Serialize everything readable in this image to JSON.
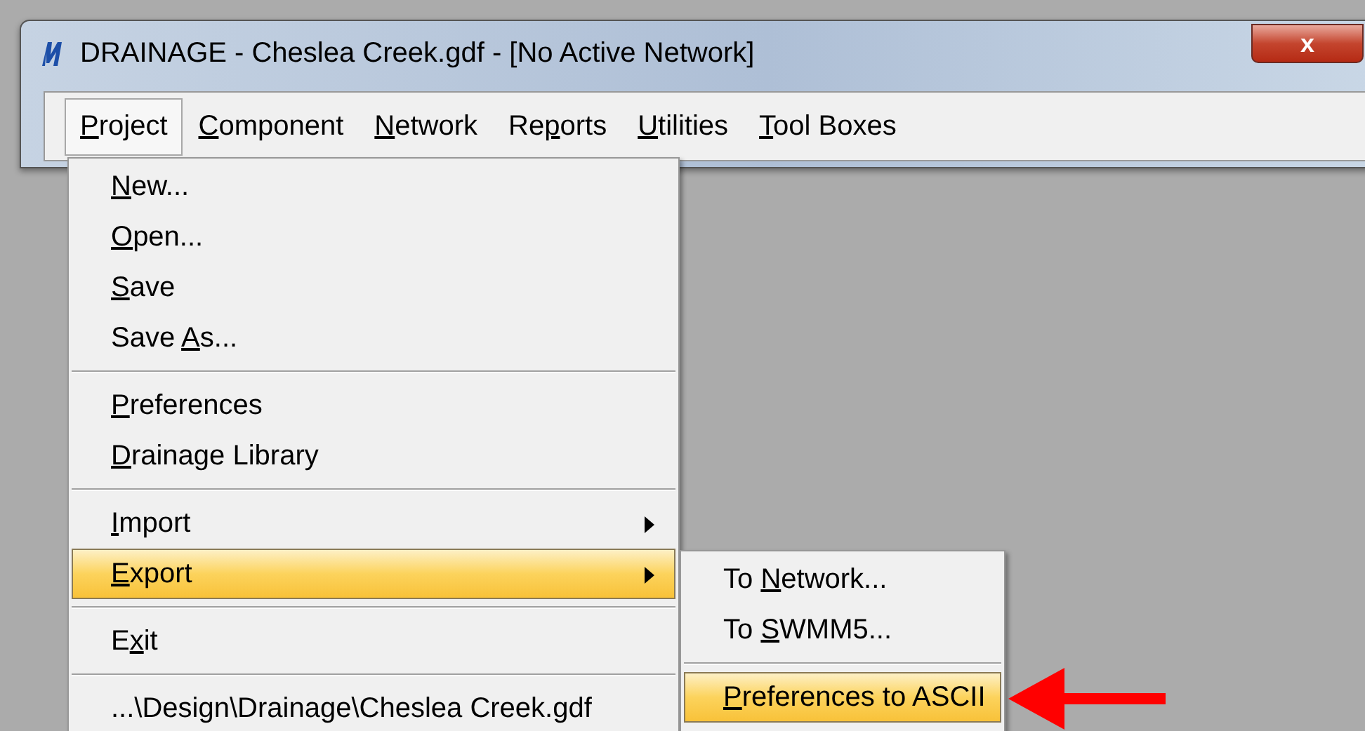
{
  "window": {
    "title": "DRAINAGE - Cheslea Creek.gdf - [No Active Network]",
    "close": "x"
  },
  "menubar": [
    {
      "label": {
        "key": "P",
        "post": "roject"
      },
      "selected": true
    },
    {
      "label": {
        "key": "C",
        "post": "omponent"
      },
      "selected": false
    },
    {
      "label": {
        "key": "N",
        "post": "etwork"
      },
      "selected": false
    },
    {
      "label": {
        "pre": "Re",
        "key": "p",
        "post": "orts"
      },
      "selected": false
    },
    {
      "label": {
        "key": "U",
        "post": "tilities"
      },
      "selected": false
    },
    {
      "label": {
        "key": "T",
        "post": "ool Boxes"
      },
      "selected": false
    }
  ],
  "project_menu": [
    {
      "kind": "item",
      "label": {
        "key": "N",
        "post": "ew..."
      },
      "selected": false,
      "submenu": false
    },
    {
      "kind": "item",
      "label": {
        "key": "O",
        "post": "pen..."
      },
      "selected": false,
      "submenu": false
    },
    {
      "kind": "item",
      "label": {
        "key": "S",
        "post": "ave"
      },
      "selected": false,
      "submenu": false
    },
    {
      "kind": "item",
      "label": {
        "pre": "Save ",
        "key": "A",
        "post": "s..."
      },
      "selected": false,
      "submenu": false
    },
    {
      "kind": "separator"
    },
    {
      "kind": "item",
      "label": {
        "key": "P",
        "post": "references"
      },
      "selected": false,
      "submenu": false
    },
    {
      "kind": "item",
      "label": {
        "key": "D",
        "post": "rainage Library"
      },
      "selected": false,
      "submenu": false
    },
    {
      "kind": "separator"
    },
    {
      "kind": "item",
      "label": {
        "key": "I",
        "post": "mport"
      },
      "selected": false,
      "submenu": true
    },
    {
      "kind": "item",
      "label": {
        "key": "E",
        "post": "xport"
      },
      "selected": true,
      "submenu": true
    },
    {
      "kind": "separator"
    },
    {
      "kind": "item",
      "label": {
        "pre": "E",
        "key": "x",
        "post": "it"
      },
      "selected": false,
      "submenu": false
    },
    {
      "kind": "separator"
    },
    {
      "kind": "item",
      "label": {
        "pre": "...\\Design\\Drainage\\Cheslea Creek.gdf"
      },
      "selected": false,
      "submenu": false
    }
  ],
  "export_menu": [
    {
      "kind": "item",
      "label": {
        "pre": "To ",
        "key": "N",
        "post": "etwork..."
      },
      "selected": false,
      "submenu": false
    },
    {
      "kind": "item",
      "label": {
        "pre": "To ",
        "key": "S",
        "post": "WMM5..."
      },
      "selected": false,
      "submenu": false
    },
    {
      "kind": "separator"
    },
    {
      "kind": "item",
      "label": {
        "key": "P",
        "post": "references to ASCII"
      },
      "selected": true,
      "submenu": false
    }
  ]
}
